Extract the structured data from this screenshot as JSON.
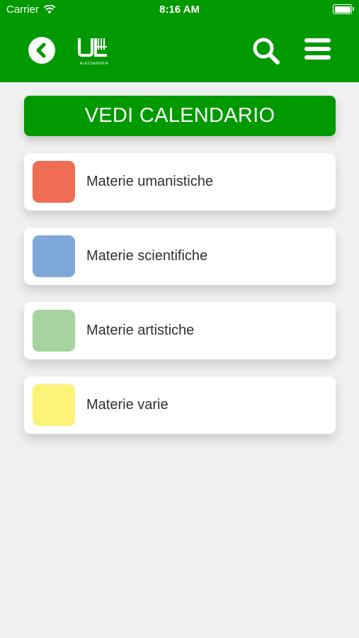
{
  "status_bar": {
    "carrier": "Carrier",
    "time": "8:16 AM"
  },
  "nav": {
    "back_icon": "chevron-left-circle-icon",
    "logo_mark": "UE",
    "logo_subtitle": "ALESSANDRIA",
    "search_icon": "search-icon",
    "menu_icon": "hamburger-menu-icon"
  },
  "calendar_button": {
    "label": "VEDI CALENDARIO"
  },
  "categories": [
    {
      "label": "Materie umanistiche",
      "color": "#ef6c55"
    },
    {
      "label": "Materie scientifiche",
      "color": "#7fa8da"
    },
    {
      "label": "Materie artistiche",
      "color": "#a5d49e"
    },
    {
      "label": "Materie varie",
      "color": "#fcf379"
    }
  ],
  "colors": {
    "brand_green": "#009900",
    "background": "#f0f0f0"
  }
}
